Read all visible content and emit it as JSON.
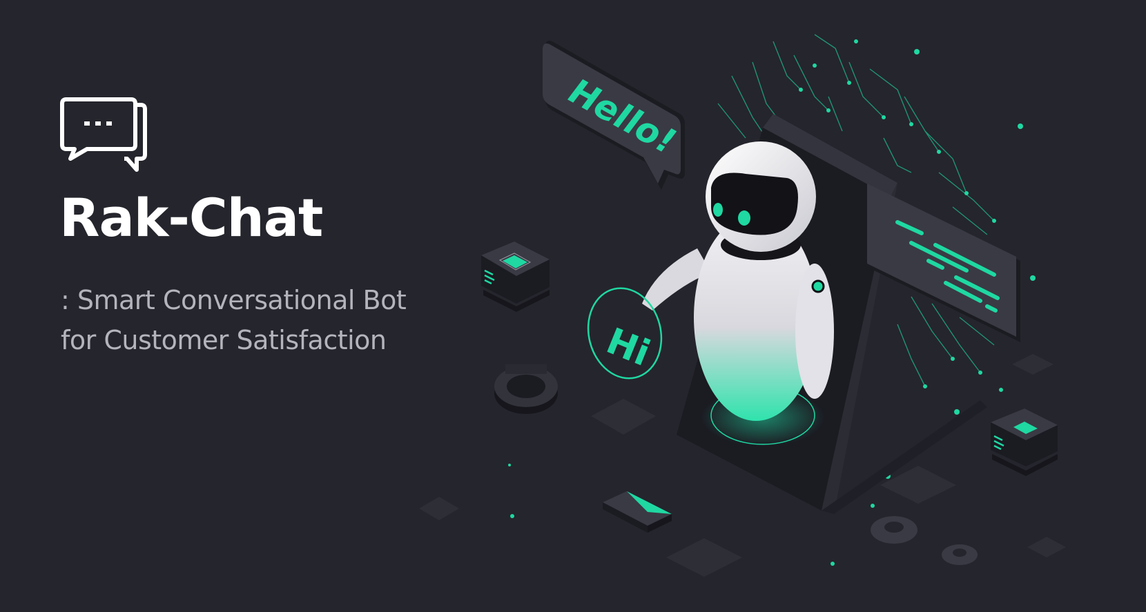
{
  "brand": {
    "icon": "chat-bubbles-icon",
    "title": "Rak-Chat",
    "subtitle_line1": ": Smart Conversational Bot",
    "subtitle_line2": "for Customer Satisfaction"
  },
  "illustration": {
    "bubble_left_text": "Hello!",
    "bubble_circle_text": "Hi"
  },
  "colors": {
    "background": "#25252d",
    "accent": "#1fd8a2",
    "title": "#ffffff",
    "subtitle": "#b4b4bc"
  }
}
